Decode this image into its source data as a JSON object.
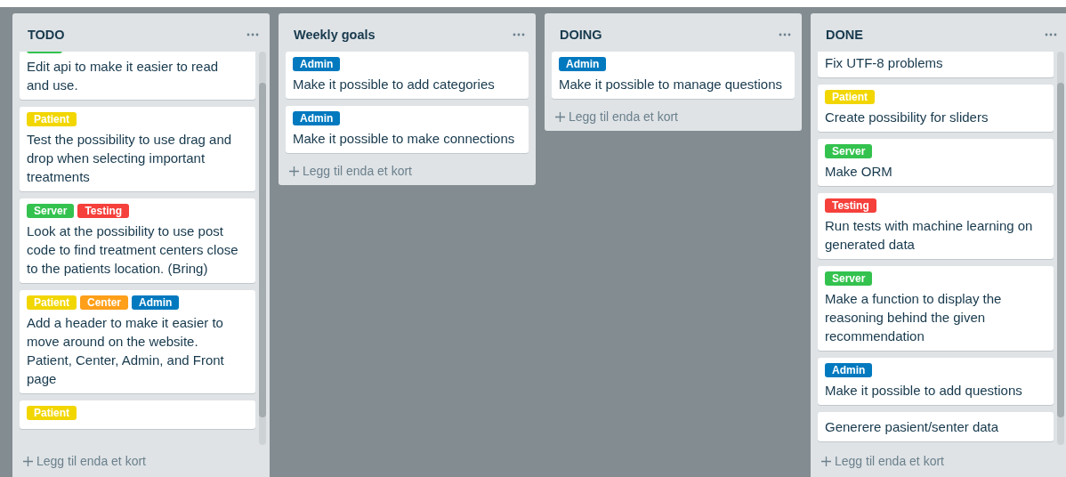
{
  "lists": [
    {
      "title": "TODO",
      "scrollable": true,
      "cards": [
        {
          "clipped_top": true,
          "labels": [
            {
              "color": "#34c24f"
            }
          ],
          "text": "Edit api to make it easier to read and use."
        },
        {
          "labels": [
            {
              "text": "Patient",
              "color": "#f2d600"
            }
          ],
          "text": "Test the possibility to use drag and drop when selecting important treatments"
        },
        {
          "labels": [
            {
              "text": "Server",
              "color": "#34c24f"
            },
            {
              "text": "Testing",
              "color": "#f5403b"
            }
          ],
          "text": "Look at the possibility to use post code to find treatment centers close to the patients location. (Bring)"
        },
        {
          "labels": [
            {
              "text": "Patient",
              "color": "#f2d600"
            },
            {
              "text": "Center",
              "color": "#ff9f1a"
            },
            {
              "text": "Admin",
              "color": "#0079bf"
            }
          ],
          "text": "Add a header to make it easier to move around on the website. Patient, Center, Admin, and Front page"
        },
        {
          "labels": [
            {
              "text": "Patient",
              "color": "#f2d600"
            }
          ]
        }
      ],
      "add_card": "Legg til enda et kort"
    },
    {
      "title": "Weekly goals",
      "scrollable": false,
      "cards": [
        {
          "labels": [
            {
              "text": "Admin",
              "color": "#0079bf"
            }
          ],
          "text": "Make it possible to add categories"
        },
        {
          "labels": [
            {
              "text": "Admin",
              "color": "#0079bf"
            }
          ],
          "text": "Make it possible to make connections"
        }
      ],
      "add_card": "Legg til enda et kort"
    },
    {
      "title": "DOING",
      "scrollable": false,
      "cards": [
        {
          "labels": [
            {
              "text": "Admin",
              "color": "#0079bf"
            }
          ],
          "text": "Make it possible to manage questions"
        }
      ],
      "add_card": "Legg til enda et kort"
    },
    {
      "title": "DONE",
      "scrollable": true,
      "cards": [
        {
          "clipped_top": true,
          "text": "Fix UTF-8 problems"
        },
        {
          "labels": [
            {
              "text": "Patient",
              "color": "#f2d600"
            }
          ],
          "text": "Create possibility for sliders"
        },
        {
          "labels": [
            {
              "text": "Server",
              "color": "#34c24f"
            }
          ],
          "text": "Make ORM"
        },
        {
          "labels": [
            {
              "text": "Testing",
              "color": "#f5403b"
            }
          ],
          "text": "Run tests with machine learning on generated data"
        },
        {
          "labels": [
            {
              "text": "Server",
              "color": "#34c24f"
            }
          ],
          "text": "Make a function to display the reasoning behind the given recommendation"
        },
        {
          "labels": [
            {
              "text": "Admin",
              "color": "#0079bf"
            }
          ],
          "text": "Make it possible to add questions"
        },
        {
          "text": "Generere pasient/senter data"
        }
      ],
      "add_card": "Legg til enda et kort"
    }
  ]
}
